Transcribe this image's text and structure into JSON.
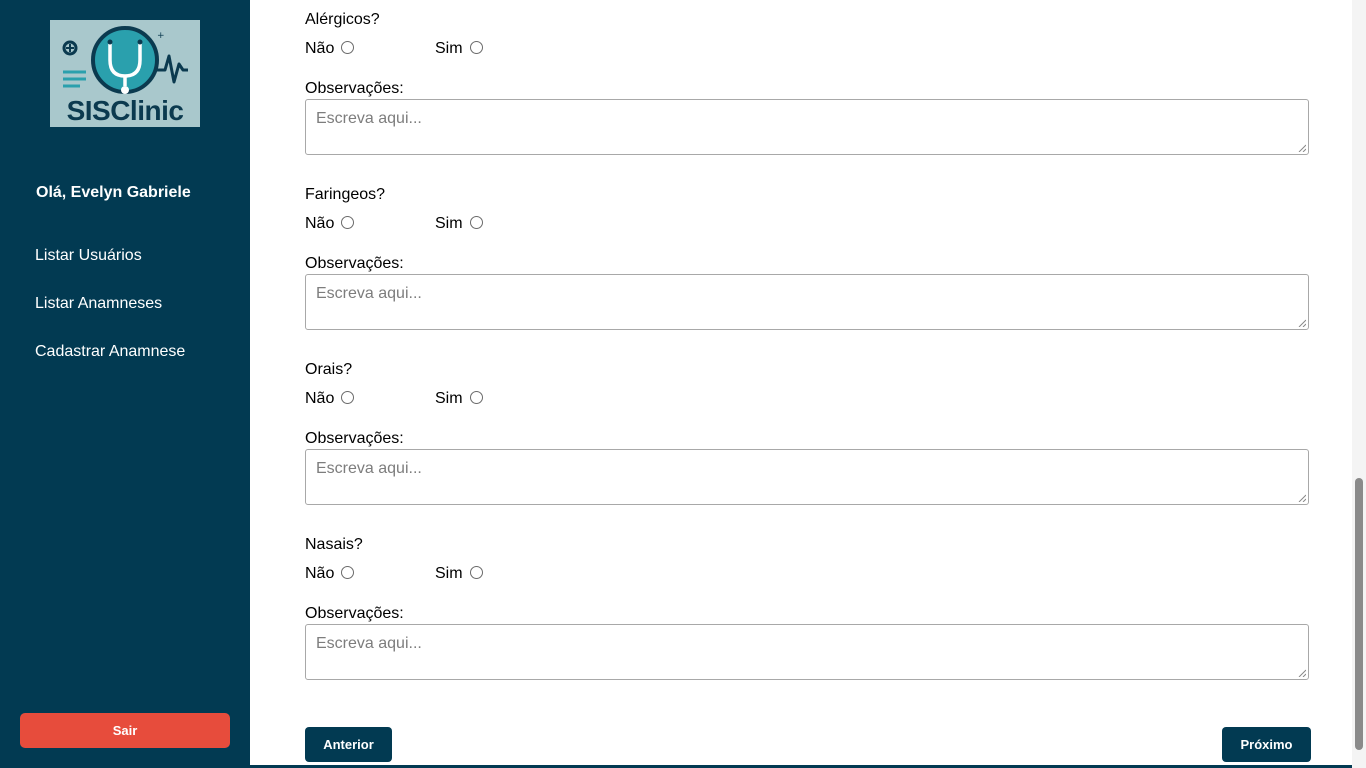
{
  "sidebar": {
    "logo_text": "SISClinic",
    "greeting": "Olá, Evelyn Gabriele",
    "nav": [
      {
        "label": "Listar Usuários"
      },
      {
        "label": "Listar Anamneses"
      },
      {
        "label": "Cadastrar Anamnese"
      }
    ],
    "logout_label": "Sair"
  },
  "form": {
    "questions": [
      {
        "label": "Alérgicos?",
        "no_label": "Não",
        "yes_label": "Sim",
        "obs_label": "Observações:",
        "placeholder": "Escreva aqui..."
      },
      {
        "label": "Faringeos?",
        "no_label": "Não",
        "yes_label": "Sim",
        "obs_label": "Observações:",
        "placeholder": "Escreva aqui..."
      },
      {
        "label": "Orais?",
        "no_label": "Não",
        "yes_label": "Sim",
        "obs_label": "Observações:",
        "placeholder": "Escreva aqui..."
      },
      {
        "label": "Nasais?",
        "no_label": "Não",
        "yes_label": "Sim",
        "obs_label": "Observações:",
        "placeholder": "Escreva aqui..."
      }
    ],
    "prev_label": "Anterior",
    "next_label": "Próximo"
  },
  "colors": {
    "sidebar_bg": "#023a52",
    "logout_bg": "#e74c3c",
    "button_bg": "#023a52"
  },
  "icons": {
    "logo": "stethoscope-heartbeat-icon",
    "resize_grip": "resize-grip-icon"
  }
}
